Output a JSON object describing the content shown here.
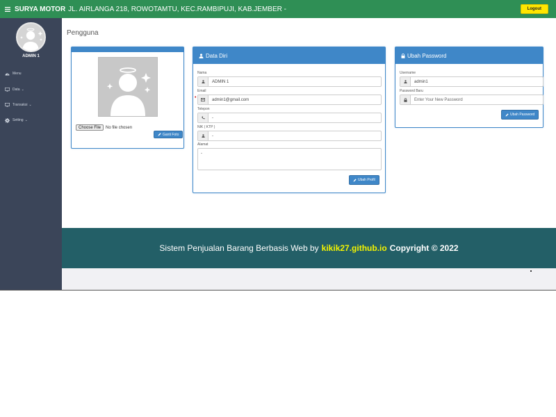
{
  "topbar": {
    "brand": "SURYA MOTOR",
    "address": "JL. AIRLANGA 218, ROWOTAMTU, KEC.RAMBIPUJI, KAB.JEMBER -",
    "logout_label": "Logout"
  },
  "sidebar": {
    "user_name": "ADMIN 1",
    "items": [
      {
        "label": "Menu",
        "icon": "dashboard-icon",
        "has_chevron": false
      },
      {
        "label": "Data",
        "icon": "monitor-icon",
        "has_chevron": true
      },
      {
        "label": "Transaksi",
        "icon": "monitor-icon",
        "has_chevron": true
      },
      {
        "label": "Setting",
        "icon": "gear-icon",
        "has_chevron": true
      }
    ]
  },
  "main": {
    "page_title": "Pengguna",
    "photo": {
      "choose_file_label": "Choose File",
      "no_file_text": "No file chosen",
      "change_photo_label": "Ganti Foto"
    },
    "profile": {
      "title": "Data Diri",
      "fields": {
        "nama_label": "Nama",
        "nama_value": "ADMIN 1",
        "email_label": "Email",
        "email_value": "admin1@gmail.com",
        "telepon_label": "Telepon",
        "telepon_value": "-",
        "nik_label": "NIK ( KTP )",
        "nik_value": "-",
        "alamat_label": "Alamat",
        "alamat_value": "-"
      },
      "save_label": "Ubah Profil"
    },
    "password": {
      "title": "Ubah Password",
      "username_label": "Username",
      "username_value": "admin1",
      "new_password_label": "Password Baru",
      "new_password_placeholder": "Enter Your New Password",
      "save_label": "Ubah Password"
    }
  },
  "footer": {
    "text": "Sistem Penjualan Barang Berbasis Web by",
    "link": "kikik27.github.io",
    "copyright": "Copyright © 2022"
  },
  "colors": {
    "topbar": "#2f8f55",
    "sidebar": "#3b4559",
    "panel_blue": "#3f87c8",
    "logout_yellow": "#ffe600",
    "footer": "#235f67",
    "footer_link": "#f4f400"
  }
}
